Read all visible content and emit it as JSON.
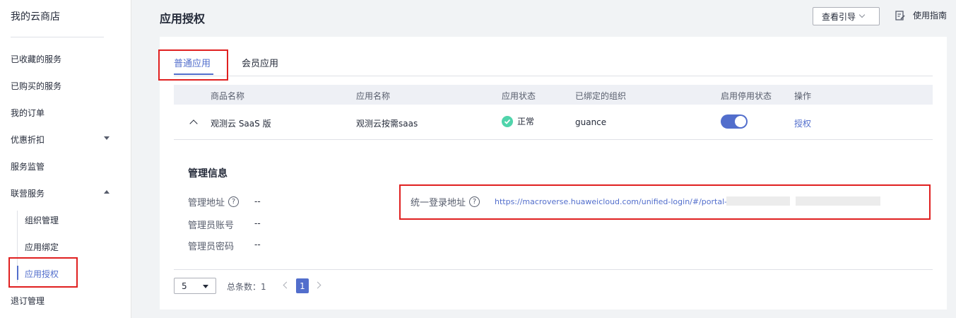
{
  "sidebar": {
    "title": "我的云商店",
    "items": [
      {
        "label": "已收藏的服务"
      },
      {
        "label": "已购买的服务"
      },
      {
        "label": "我的订单"
      },
      {
        "label": "优惠折扣"
      },
      {
        "label": "服务监管"
      },
      {
        "label": "联营服务"
      },
      {
        "label": "退订管理"
      }
    ],
    "sub_items": [
      {
        "label": "组织管理"
      },
      {
        "label": "应用绑定"
      },
      {
        "label": "应用授权"
      }
    ],
    "active_item": "应用授权"
  },
  "header": {
    "title": "应用授权",
    "guide_button": "查看引导",
    "manual_link": "使用指南"
  },
  "tabs": [
    {
      "label": "普通应用",
      "active": true
    },
    {
      "label": "会员应用",
      "active": false
    }
  ],
  "table": {
    "columns": [
      "商品名称",
      "应用名称",
      "应用状态",
      "已绑定的组织",
      "启用停用状态",
      "操作"
    ],
    "rows": [
      {
        "product": "观测云 SaaS 版",
        "app_name": "观测云按需saas",
        "status": "正常",
        "organization": "guance",
        "enabled": true,
        "action": "授权"
      }
    ]
  },
  "detail": {
    "title": "管理信息",
    "manage_url_label": "管理地址",
    "manage_url_value": "--",
    "admin_account_label": "管理员账号",
    "admin_account_value": "--",
    "admin_password_label": "管理员密码",
    "admin_password_value": "--",
    "sso_label": "统一登录地址",
    "sso_url": "https://macroverse.huaweicloud.com/unified-login/#/portal-lc                                                            a4d80e…"
  },
  "pagination": {
    "page_size": "5",
    "total_label": "总条数：1",
    "current_page": "1"
  },
  "colors": {
    "accent": "#526ecc",
    "highlight_box": "#e02020",
    "status_ok": "#50d4ab"
  }
}
